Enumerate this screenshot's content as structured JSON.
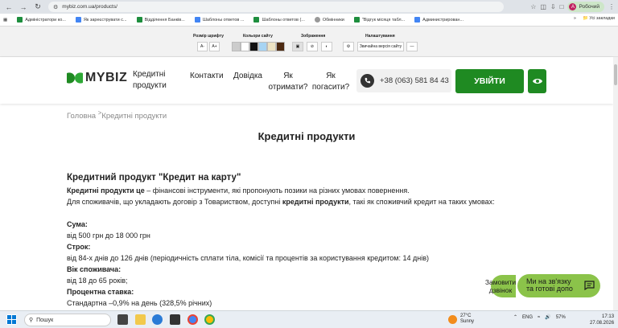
{
  "browser": {
    "url": "mybiz.com.ua/products/",
    "profile_initial": "A",
    "profile_label": "Робочий"
  },
  "bookmarks": {
    "items": [
      {
        "label": "Адміністратори ко...",
        "color": "#1e8e3e"
      },
      {
        "label": "Як зареєструвати с...",
        "color": "#4285f4"
      },
      {
        "label": "Відділення Банків...",
        "color": "#1e8e3e"
      },
      {
        "label": "Шаблоны ответов ...",
        "color": "#4285f4"
      },
      {
        "label": "Шаблоны ответов (...",
        "color": "#1e8e3e"
      },
      {
        "label": "Обмінники",
        "color": "#999999"
      },
      {
        "label": "\"Відгук місяця табл...",
        "color": "#1e8e3e"
      },
      {
        "label": "Администрирован...",
        "color": "#4285f4"
      }
    ],
    "more": "»",
    "all_label": "Усі закладки"
  },
  "a11y": {
    "font_size_label": "Розмір шрифту",
    "font_minus": "A-",
    "font_plus": "A+",
    "colors_label": "Кольори сайту",
    "colors": [
      "#cccccc",
      "#ffffff",
      "#111111",
      "#a7d4f3",
      "#ede3c4",
      "#4d2a12"
    ],
    "images_label": "Зображення",
    "settings_label": "Налаштування",
    "normal_version": "Звичайна версія сайту"
  },
  "header": {
    "logo": "MYBIZ",
    "nav": [
      {
        "line1": "Кредитні",
        "line2": "продукти"
      },
      {
        "line1": "Контакти",
        "line2": ""
      },
      {
        "line1": "Довідка",
        "line2": ""
      },
      {
        "line1": "Як",
        "line2": "отримати?"
      },
      {
        "line1": "Як",
        "line2": "погасити?"
      }
    ],
    "phone": "+38 (063) 581 84 43",
    "login": "УВІЙТИ",
    "brand_color": "#1f8a22"
  },
  "breadcrumb": {
    "home": "Головна",
    "sep": ">",
    "current": "Кредитні продукти"
  },
  "page": {
    "title": "Кредитні продукти",
    "product_heading": "Кредитний продукт \"Кредит на карту\"",
    "intro_bold": "Кредитні продукти це",
    "intro_rest": " – фінансові інструменти, які пропонують позики на різних умовах повернення.",
    "consumers_pre": "Для споживачів, що укладають договір з Товариством, доступні ",
    "consumers_bold": "кредитні продукти",
    "consumers_post": ", такі як споживчий кредит на таких умовах:",
    "sum_label": "Сума:",
    "sum_value": "від 500 грн до 18 000 грн",
    "term_label": "Строк:",
    "term_value": "від 84-х днів до 126 днів (періодичність сплати тіла, комісії та процентів за користування кредитом: 14 днів)",
    "age_label": "Вік споживача:",
    "age_value": "від 18 до 65 років;",
    "rate_label": "Процентна ставка:",
    "rate_value": "Стандартна –0,9% на день (328,5% річних)"
  },
  "widgets": {
    "callback_line1": "Замовити",
    "callback_line2": "дзвінок",
    "chat_line1": "Ми на зв'язку",
    "chat_line2": "та готові допо"
  },
  "taskbar": {
    "search": "Пошук",
    "temp": "27°C",
    "weather": "Sunny",
    "lang": "ENG",
    "battery": "57%",
    "time": "17:13",
    "date": "27.08.2026"
  }
}
